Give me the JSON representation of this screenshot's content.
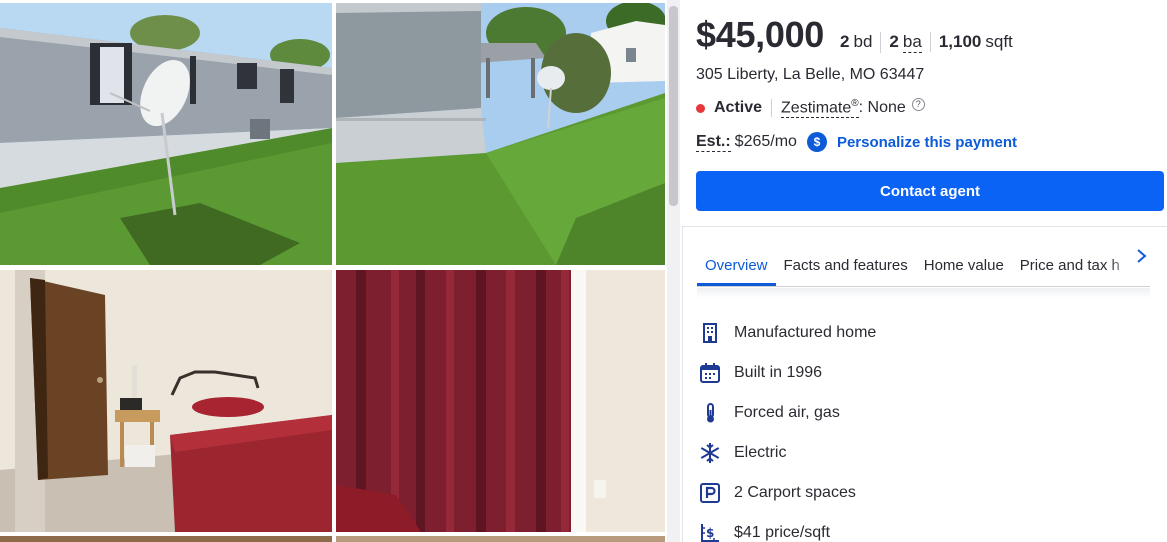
{
  "listing": {
    "price": "$45,000",
    "beds_value": "2",
    "beds_unit": "bd",
    "baths_value": "2",
    "baths_unit": "ba",
    "sqft_value": "1,100",
    "sqft_unit": "sqft",
    "address": "305 Liberty, La Belle, MO 63447",
    "status": "Active",
    "zestimate_label": "Zestimate",
    "zestimate_mark": "®",
    "zestimate_value": ": None",
    "help_glyph": "?",
    "est_label": "Est.:",
    "est_value": "$265/mo",
    "est_icon_glyph": "$",
    "personalize_link": "Personalize this payment",
    "contact_button": "Contact agent"
  },
  "tabs": [
    {
      "label": "Overview",
      "active": true
    },
    {
      "label": "Facts and features",
      "active": false
    },
    {
      "label": "Home value",
      "active": false
    },
    {
      "label": "Price and tax h",
      "active": false
    }
  ],
  "features": [
    {
      "icon": "building-icon",
      "text": "Manufactured home"
    },
    {
      "icon": "calendar-icon",
      "text": "Built in 1996"
    },
    {
      "icon": "thermometer-icon",
      "text": "Forced air, gas"
    },
    {
      "icon": "snowflake-icon",
      "text": "Electric"
    },
    {
      "icon": "parking-icon",
      "text": "2 Carport spaces"
    },
    {
      "icon": "price-per-sqft-icon",
      "text": "$41 price/sqft"
    }
  ],
  "colors": {
    "accent": "#0d5bd7",
    "button": "#0b63f6",
    "status_active": "#e6383a",
    "text": "#2a2a33"
  },
  "photos": [
    {
      "name": "photo-exterior-side"
    },
    {
      "name": "photo-exterior-yard"
    },
    {
      "name": "photo-bedroom"
    },
    {
      "name": "photo-curtains"
    },
    {
      "name": "photo-5"
    },
    {
      "name": "photo-6"
    }
  ]
}
